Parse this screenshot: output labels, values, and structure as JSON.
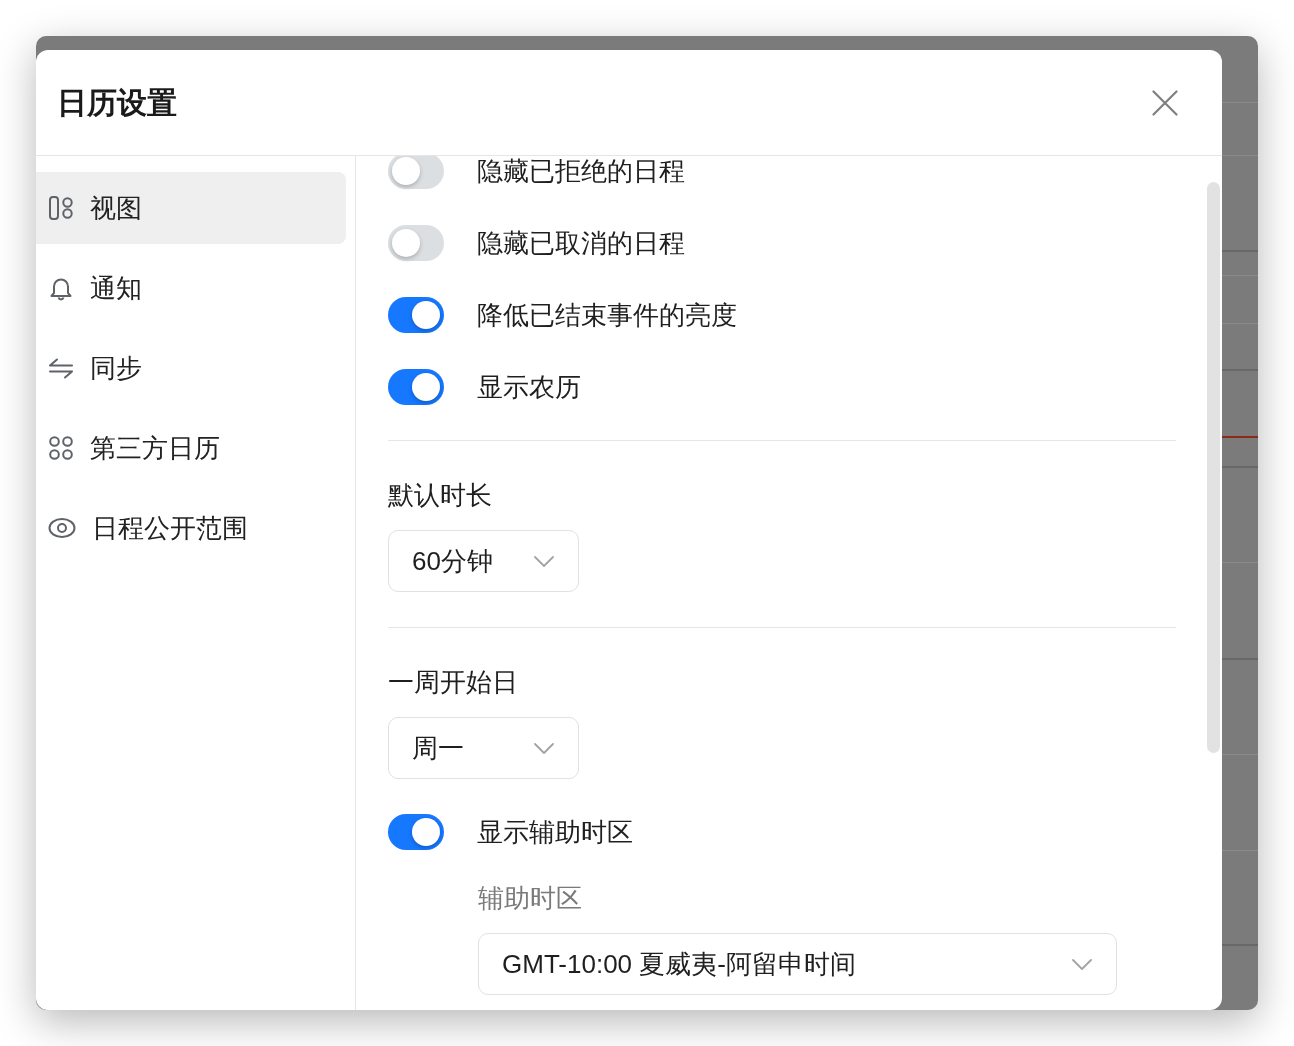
{
  "dialog": {
    "title": "日历设置"
  },
  "sidebar": {
    "items": [
      {
        "label": "视图",
        "selected": true
      },
      {
        "label": "通知",
        "selected": false
      },
      {
        "label": "同步",
        "selected": false
      },
      {
        "label": "第三方日历",
        "selected": false
      },
      {
        "label": "日程公开范围",
        "selected": false
      }
    ]
  },
  "settings": {
    "sections": [
      {
        "items": [
          {
            "kind": "toggle",
            "label": "隐藏已拒绝的日程",
            "on": false
          },
          {
            "kind": "toggle",
            "label": "隐藏已取消的日程",
            "on": false
          },
          {
            "kind": "toggle",
            "label": "降低已结束事件的亮度",
            "on": true
          },
          {
            "kind": "toggle",
            "label": "显示农历",
            "on": true
          }
        ]
      },
      {
        "items": [
          {
            "kind": "select",
            "label": "默认时长",
            "value": "60分钟"
          }
        ]
      },
      {
        "items": [
          {
            "kind": "select",
            "label": "一周开始日",
            "value": "周一"
          },
          {
            "kind": "toggle",
            "label": "显示辅助时区",
            "on": true,
            "children": [
              {
                "kind": "select",
                "label": "辅助时区",
                "value": "GMT-10:00 夏威夷-阿留申时间"
              }
            ]
          }
        ]
      }
    ]
  }
}
